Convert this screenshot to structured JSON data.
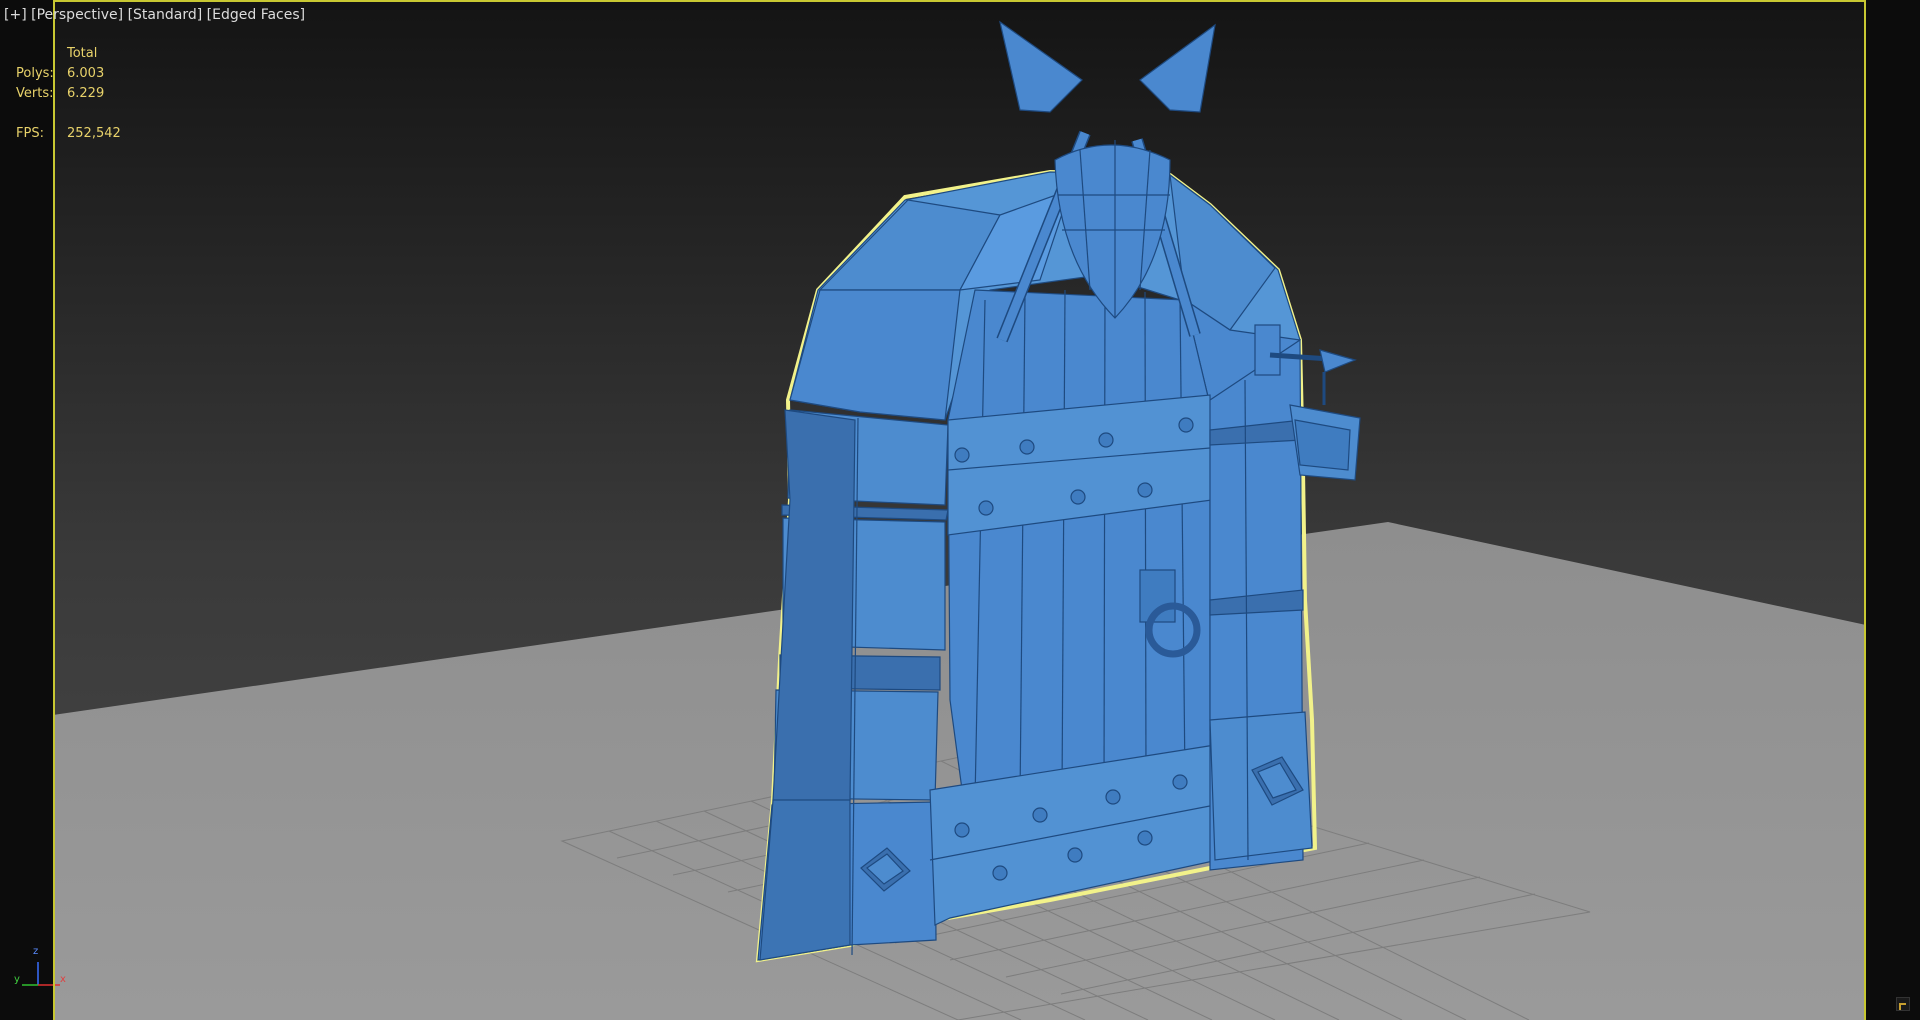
{
  "viewport": {
    "label_plus": "[+]",
    "label_view": "[Perspective]",
    "label_shading": "[Standard]",
    "label_mode": "[Edged Faces]"
  },
  "stats": {
    "header": "Total",
    "polys_label": "Polys:",
    "polys_value": "6.003",
    "verts_label": "Verts:",
    "verts_value": "6.229",
    "fps_label": "FPS:",
    "fps_value": "252,542"
  },
  "axis_gizmo": {
    "z": "z",
    "y": "y",
    "x": "x"
  },
  "colors": {
    "model": "#4a88cf",
    "selection_outline": "#f2f28a",
    "viewport_border": "#c8c832",
    "stats_text": "#e8d26a",
    "floor": "#8c8c8c",
    "grid": "#7a7a7a"
  }
}
